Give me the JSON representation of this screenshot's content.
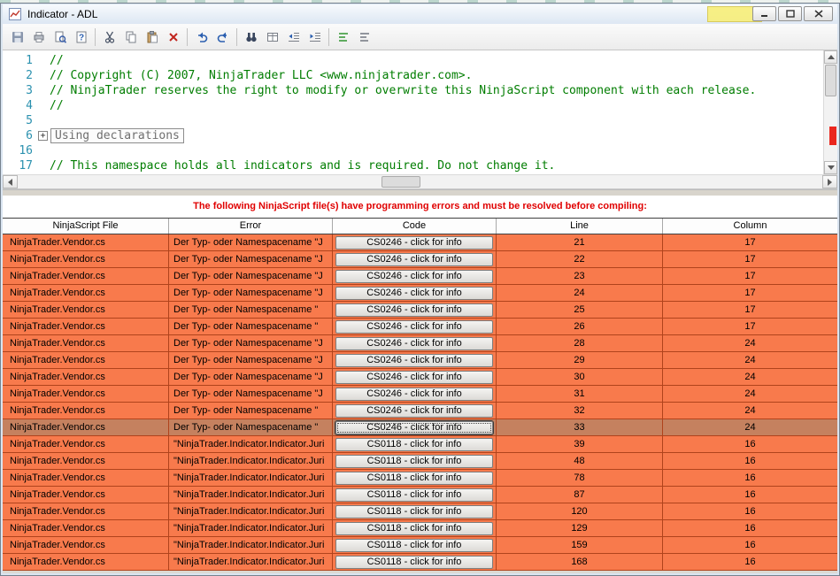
{
  "window": {
    "title": "Indicator - ADL"
  },
  "toolbar": {
    "icons": [
      "save",
      "print",
      "print-preview",
      "help",
      "cut",
      "copy",
      "paste",
      "delete",
      "undo",
      "redo",
      "find",
      "find-next",
      "outdent",
      "indent",
      "comment",
      "uncomment"
    ]
  },
  "editor": {
    "lines": [
      {
        "num": "1",
        "type": "comment",
        "text": "//"
      },
      {
        "num": "2",
        "type": "comment",
        "text": "// Copyright (C) 2007, NinjaTrader LLC <www.ninjatrader.com>."
      },
      {
        "num": "3",
        "type": "comment",
        "text": "// NinjaTrader reserves the right to modify or overwrite this NinjaScript component with each release."
      },
      {
        "num": "4",
        "type": "comment",
        "text": "//"
      },
      {
        "num": "5",
        "type": "blank",
        "text": ""
      },
      {
        "num": "6",
        "type": "collapsed",
        "text": "Using declarations"
      },
      {
        "num": "16",
        "type": "blank",
        "text": ""
      },
      {
        "num": "17",
        "type": "comment",
        "text": "// This namespace holds all indicators and is required. Do not change it."
      }
    ]
  },
  "colors": {
    "row_orange": "#F87A4C",
    "row_selected": "#C5815F",
    "error_message_red": "#E00000",
    "comment_green": "#007D00",
    "line_number_teal": "#2B91AF",
    "scroll_marker_red": "#EA271E"
  },
  "errorPanel": {
    "message": "The following NinjaScript file(s) have programming errors and must be resolved before compiling:",
    "columns": [
      "NinjaScript File",
      "Error",
      "Code",
      "Line",
      "Column"
    ],
    "rows": [
      {
        "file": "NinjaTrader.Vendor.cs",
        "error": "Der Typ- oder Namespacename \"J",
        "code": "CS0246 - click for info",
        "line": "21",
        "column": "17",
        "selected": false
      },
      {
        "file": "NinjaTrader.Vendor.cs",
        "error": "Der Typ- oder Namespacename \"J",
        "code": "CS0246 - click for info",
        "line": "22",
        "column": "17",
        "selected": false
      },
      {
        "file": "NinjaTrader.Vendor.cs",
        "error": "Der Typ- oder Namespacename \"J",
        "code": "CS0246 - click for info",
        "line": "23",
        "column": "17",
        "selected": false
      },
      {
        "file": "NinjaTrader.Vendor.cs",
        "error": "Der Typ- oder Namespacename \"J",
        "code": "CS0246 - click for info",
        "line": "24",
        "column": "17",
        "selected": false
      },
      {
        "file": "NinjaTrader.Vendor.cs",
        "error": "Der Typ- oder Namespacename \"",
        "code": "CS0246 - click for info",
        "line": "25",
        "column": "17",
        "selected": false
      },
      {
        "file": "NinjaTrader.Vendor.cs",
        "error": "Der Typ- oder Namespacename \"",
        "code": "CS0246 - click for info",
        "line": "26",
        "column": "17",
        "selected": false
      },
      {
        "file": "NinjaTrader.Vendor.cs",
        "error": "Der Typ- oder Namespacename \"J",
        "code": "CS0246 - click for info",
        "line": "28",
        "column": "24",
        "selected": false
      },
      {
        "file": "NinjaTrader.Vendor.cs",
        "error": "Der Typ- oder Namespacename \"J",
        "code": "CS0246 - click for info",
        "line": "29",
        "column": "24",
        "selected": false
      },
      {
        "file": "NinjaTrader.Vendor.cs",
        "error": "Der Typ- oder Namespacename \"J",
        "code": "CS0246 - click for info",
        "line": "30",
        "column": "24",
        "selected": false
      },
      {
        "file": "NinjaTrader.Vendor.cs",
        "error": "Der Typ- oder Namespacename \"J",
        "code": "CS0246 - click for info",
        "line": "31",
        "column": "24",
        "selected": false
      },
      {
        "file": "NinjaTrader.Vendor.cs",
        "error": "Der Typ- oder Namespacename \"",
        "code": "CS0246 - click for info",
        "line": "32",
        "column": "24",
        "selected": false
      },
      {
        "file": "NinjaTrader.Vendor.cs",
        "error": "Der Typ- oder Namespacename \"",
        "code": "CS0246 - click for info",
        "line": "33",
        "column": "24",
        "selected": true
      },
      {
        "file": "NinjaTrader.Vendor.cs",
        "error": "\"NinjaTrader.Indicator.Indicator.Juri",
        "code": "CS0118 - click for info",
        "line": "39",
        "column": "16",
        "selected": false
      },
      {
        "file": "NinjaTrader.Vendor.cs",
        "error": "\"NinjaTrader.Indicator.Indicator.Juri",
        "code": "CS0118 - click for info",
        "line": "48",
        "column": "16",
        "selected": false
      },
      {
        "file": "NinjaTrader.Vendor.cs",
        "error": "\"NinjaTrader.Indicator.Indicator.Juri",
        "code": "CS0118 - click for info",
        "line": "78",
        "column": "16",
        "selected": false
      },
      {
        "file": "NinjaTrader.Vendor.cs",
        "error": "\"NinjaTrader.Indicator.Indicator.Juri",
        "code": "CS0118 - click for info",
        "line": "87",
        "column": "16",
        "selected": false
      },
      {
        "file": "NinjaTrader.Vendor.cs",
        "error": "\"NinjaTrader.Indicator.Indicator.Juri",
        "code": "CS0118 - click for info",
        "line": "120",
        "column": "16",
        "selected": false
      },
      {
        "file": "NinjaTrader.Vendor.cs",
        "error": "\"NinjaTrader.Indicator.Indicator.Juri",
        "code": "CS0118 - click for info",
        "line": "129",
        "column": "16",
        "selected": false
      },
      {
        "file": "NinjaTrader.Vendor.cs",
        "error": "\"NinjaTrader.Indicator.Indicator.Juri",
        "code": "CS0118 - click for info",
        "line": "159",
        "column": "16",
        "selected": false
      },
      {
        "file": "NinjaTrader.Vendor.cs",
        "error": "\"NinjaTrader.Indicator.Indicator.Juri",
        "code": "CS0118 - click for info",
        "line": "168",
        "column": "16",
        "selected": false
      }
    ]
  }
}
